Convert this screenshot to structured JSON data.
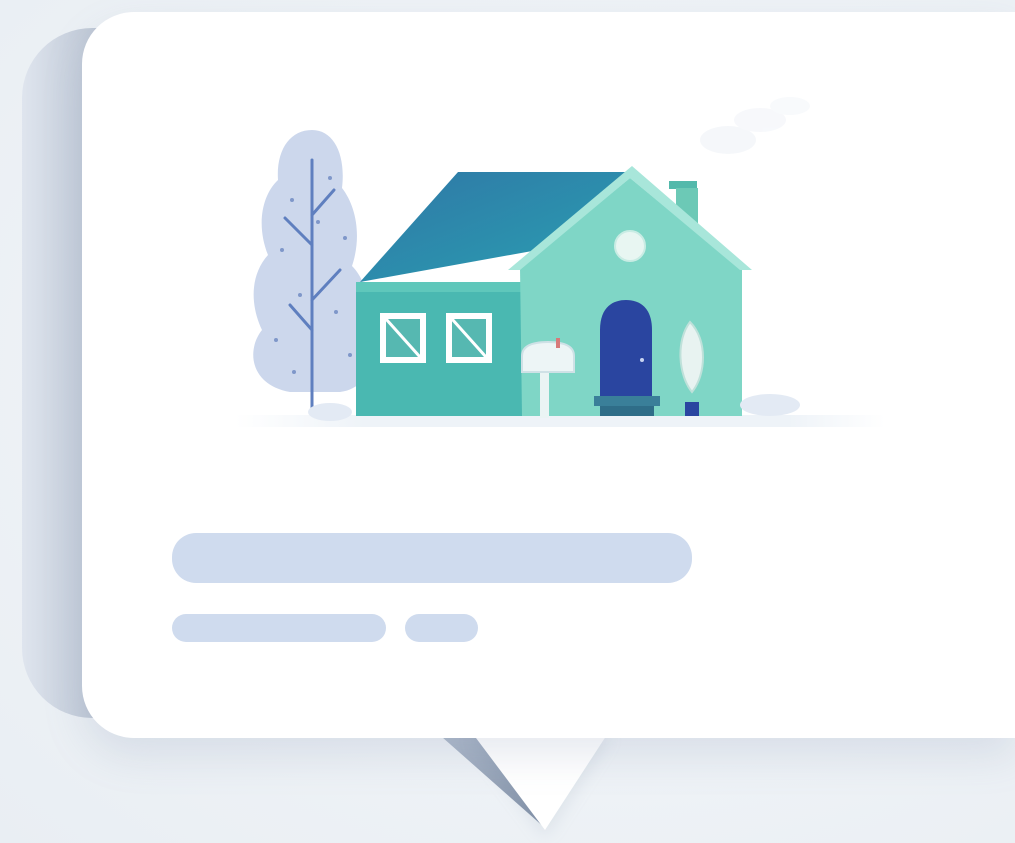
{
  "scene": {
    "subject": "house-illustration",
    "colors": {
      "background": "#eef2f6",
      "card": "#ffffff",
      "placeholder_bar": "#cfdbee",
      "roof": "#2d86a8",
      "house_front": "#7ed6c8",
      "house_side": "#4bbfb8",
      "door": "#2f4fa6",
      "tree": "#c9d6ec"
    }
  },
  "placeholders": {
    "lines": 3
  }
}
